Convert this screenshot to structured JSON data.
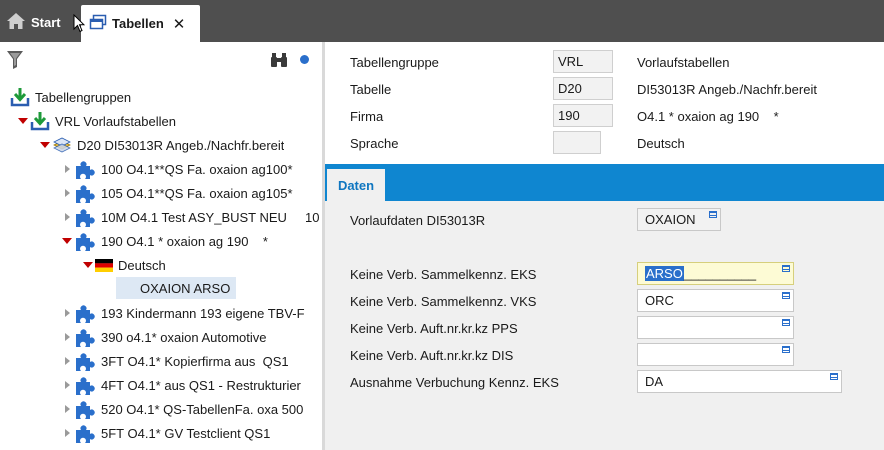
{
  "tabs": {
    "start_label": "Start",
    "active_label": "Tabellen"
  },
  "tree": {
    "root": "Tabellengruppen",
    "group": "VRL  Vorlaufstabellen",
    "table": "D20  DI53013R Angeb./Nachfr.bereit",
    "items": [
      "100 O4.1**QS Fa. oxaion ag100*",
      "105 O4.1**QS Fa. oxaion ag105*",
      "10M O4.1 Test ASY_BUST NEU     10",
      "190 O4.1 * oxaion ag 190    *",
      "Deutsch",
      "OXAION  ARSO",
      "193 Kindermann 193 eigene TBV-F",
      "390 o4.1* oxaion Automotive",
      "3FT O4.1* Kopierfirma aus  QS1",
      "4FT O4.1* aus QS1 - Restrukturier",
      "520 O4.1* QS-TabellenFa. oxa 500",
      "5FT O4.1* GV Testclient QS1"
    ]
  },
  "header": {
    "rows": [
      {
        "label": "Tabellengruppe",
        "code": "VRL",
        "desc": "Vorlaufstabellen"
      },
      {
        "label": "Tabelle",
        "code": "D20",
        "desc": "DI53013R Angeb./Nachfr.bereit"
      },
      {
        "label": "Firma",
        "code": "190",
        "desc": "O4.1 * oxaion ag 190    *"
      },
      {
        "label": "Sprache",
        "code": "",
        "desc": "Deutsch"
      }
    ]
  },
  "detail_tab": "Daten",
  "detail": {
    "vorlauf_label": "Vorlaufdaten DI53013R",
    "vorlauf_value": "OXAION",
    "fields": [
      {
        "label": "Keine Verb. Sammelkennz. EKS",
        "value": "ARSO",
        "suffix": "__________"
      },
      {
        "label": "Keine Verb. Sammelkennz. VKS",
        "value": "ORC"
      },
      {
        "label": "Keine Verb. Auft.nr.kr.kz PPS",
        "value": ""
      },
      {
        "label": "Keine Verb. Auft.nr.kr.kz DIS",
        "value": ""
      },
      {
        "label": "Ausnahme Verbuchung Kennz. EKS",
        "value": "DA"
      }
    ]
  },
  "colors": {
    "topbar": "#4f4f4f",
    "accent": "#0f86d0",
    "tree_expand": "#c00000",
    "detail_bg": "#f0f0f0",
    "highlight_field": "#fdfbd5"
  }
}
